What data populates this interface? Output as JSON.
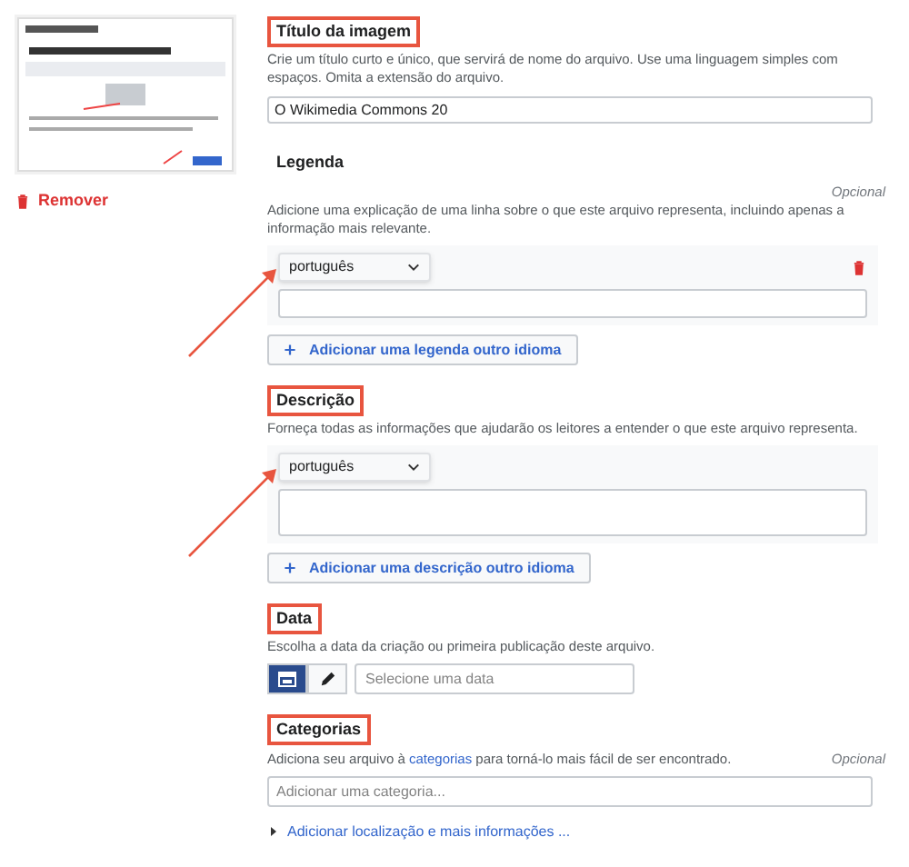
{
  "sidebar": {
    "remove_button": {
      "label": "Remover"
    }
  },
  "sections": [
    {
      "kind": "text_input",
      "title": "Título da imagem",
      "highlighted": true,
      "help": "Crie um título curto e único, que servirá de nome do arquivo. Use uma linguagem simples com espaços. Omita a extensão do arquivo.",
      "value": "O Wikimedia Commons 20"
    },
    {
      "kind": "multilingual",
      "title": "Legenda",
      "highlighted": false,
      "optional_label": "Opcional",
      "help": "Adicione uma explicação de uma linha sobre o que este arquivo representa, incluindo apenas a informação mais relevante.",
      "entries": [
        {
          "language": "português",
          "removable": true,
          "annotated": true,
          "tall": false
        }
      ],
      "add_button": "Adicionar uma legenda outro idioma"
    },
    {
      "kind": "multilingual",
      "title": "Descrição",
      "highlighted": true,
      "help": "Forneça todas as informações que ajudarão os leitores a entender o que este arquivo representa.",
      "entries": [
        {
          "language": "português",
          "removable": false,
          "annotated": true,
          "tall": true
        }
      ],
      "add_button": "Adicionar uma descrição outro idioma"
    },
    {
      "kind": "date",
      "title": "Data",
      "highlighted": true,
      "help": "Escolha a data da criação ou primeira publicação deste arquivo.",
      "modes": [
        {
          "kind": "calendar",
          "selected": true
        },
        {
          "kind": "pencil",
          "selected": false
        }
      ],
      "placeholder": "Selecione uma data"
    },
    {
      "kind": "category",
      "title": "Categorias",
      "highlighted": true,
      "optional_label": "Opcional",
      "help_before": "Adiciona seu arquivo à ",
      "help_link": "categorias",
      "help_after": " para torná-lo mais fácil de ser encontrado.",
      "placeholder": "Adicionar uma categoria..."
    }
  ],
  "more_info_link": "Adicionar localização e mais informações ..."
}
